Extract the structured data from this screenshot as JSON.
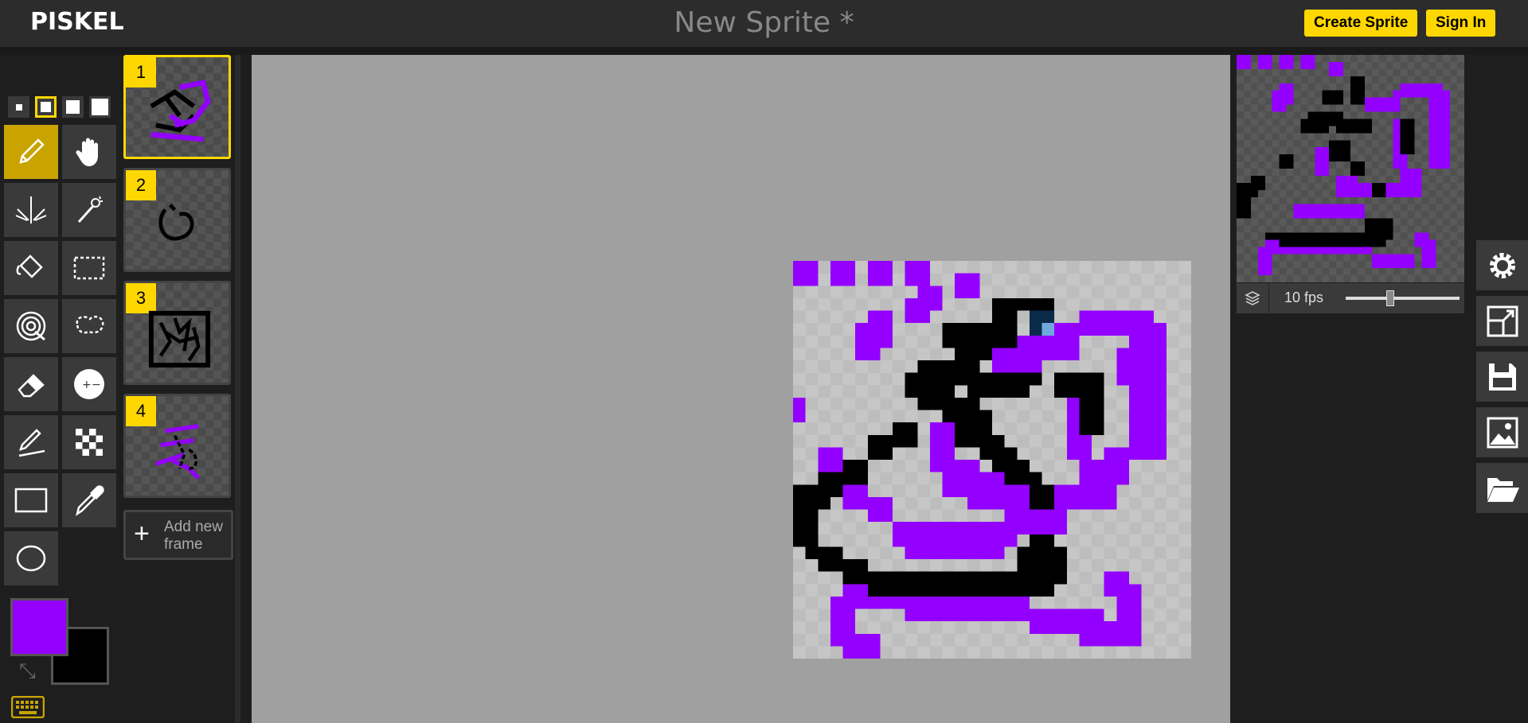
{
  "header": {
    "logo": "PISKEL",
    "title": "New Sprite *",
    "create_sprite": "Create Sprite",
    "sign_in": "Sign In"
  },
  "colors": {
    "accent": "#ffd700",
    "primary_color": "#9400ff",
    "secondary_color": "#000000"
  },
  "tools": {
    "pen_sizes": [
      "1",
      "2",
      "3",
      "4"
    ],
    "selected_pen_size": "2",
    "items": [
      "pen-tool",
      "move-tool",
      "vertical-mirror-pen",
      "magic-wand",
      "paint-bucket",
      "rectangle-selection",
      "shape-selection",
      "lasso-selection",
      "eraser",
      "lighten-darken",
      "stroke",
      "dithering",
      "rectangle",
      "color-picker",
      "circle"
    ],
    "active": "pen-tool"
  },
  "frames": {
    "items": [
      {
        "number": "1",
        "selected": true
      },
      {
        "number": "2",
        "selected": false
      },
      {
        "number": "3",
        "selected": false
      },
      {
        "number": "4",
        "selected": false
      }
    ],
    "add_label": "Add new frame"
  },
  "preview": {
    "fps_label": "10 fps",
    "fps_value": 10
  },
  "side_panel": [
    "settings-icon",
    "resize-icon",
    "save-icon",
    "export-image-icon",
    "open-folder-icon"
  ]
}
